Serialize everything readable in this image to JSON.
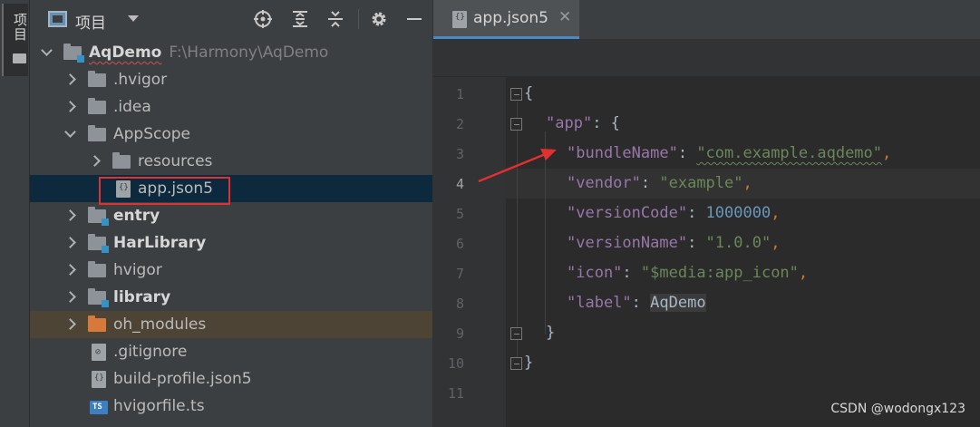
{
  "toolwindow_strip": {
    "label": "项目"
  },
  "project_panel": {
    "title": "项目",
    "toolbar_icons": [
      "crosshair-icon",
      "expand-all-icon",
      "collapse-all-icon",
      "gear-icon",
      "minimize-icon"
    ],
    "tree": [
      {
        "label": "AqDemo",
        "path": "F:\\Harmony\\AqDemo",
        "type": "module-folder",
        "expanded": true,
        "bold": true
      },
      {
        "label": ".hvigor",
        "type": "folder",
        "expanded": false
      },
      {
        "label": ".idea",
        "type": "folder",
        "expanded": false
      },
      {
        "label": "AppScope",
        "type": "folder",
        "expanded": true
      },
      {
        "label": "resources",
        "type": "folder",
        "expanded": false
      },
      {
        "label": "app.json5",
        "type": "json5-file",
        "selected": true
      },
      {
        "label": "entry",
        "type": "module-folder",
        "expanded": false,
        "bold": true
      },
      {
        "label": "HarLibrary",
        "type": "module-folder",
        "expanded": false,
        "bold": true
      },
      {
        "label": "hvigor",
        "type": "folder",
        "expanded": false
      },
      {
        "label": "library",
        "type": "module-folder",
        "expanded": false,
        "bold": true
      },
      {
        "label": "oh_modules",
        "type": "excluded-folder",
        "expanded": false
      },
      {
        "label": ".gitignore",
        "type": "gitignore-file"
      },
      {
        "label": "build-profile.json5",
        "type": "json5-file"
      },
      {
        "label": "hvigorfile.ts",
        "type": "ts-file"
      }
    ]
  },
  "editor": {
    "tab": {
      "label": "app.json5",
      "close": "✕"
    },
    "current_line": 4,
    "line_numbers": [
      "1",
      "2",
      "3",
      "4",
      "5",
      "6",
      "7",
      "8",
      "9",
      "10",
      "11"
    ],
    "code": {
      "l1_open": "{",
      "l2_key": "\"app\"",
      "l2_rest": ": {",
      "l3_key": "\"bundleName\"",
      "l3_val": "\"com.example.aqdemo\"",
      "l4_key": "\"vendor\"",
      "l4_val": "\"example\"",
      "l5_key": "\"versionCode\"",
      "l5_val": "1000000",
      "l6_key": "\"versionName\"",
      "l6_val": "\"1.0.0\"",
      "l7_key": "\"icon\"",
      "l7_val": "\"$media:app_icon\"",
      "l8_key": "\"label\"",
      "l8_val": "AqDemo",
      "l9_close": "}",
      "l10_close": "}",
      "colon": ": ",
      "comma": ","
    }
  },
  "watermark": "CSDN @wodongx123",
  "colors": {
    "annotation_red": "#e03030",
    "key_purple": "#9876aa",
    "string_green": "#6a8759",
    "number_blue": "#6897bb"
  }
}
